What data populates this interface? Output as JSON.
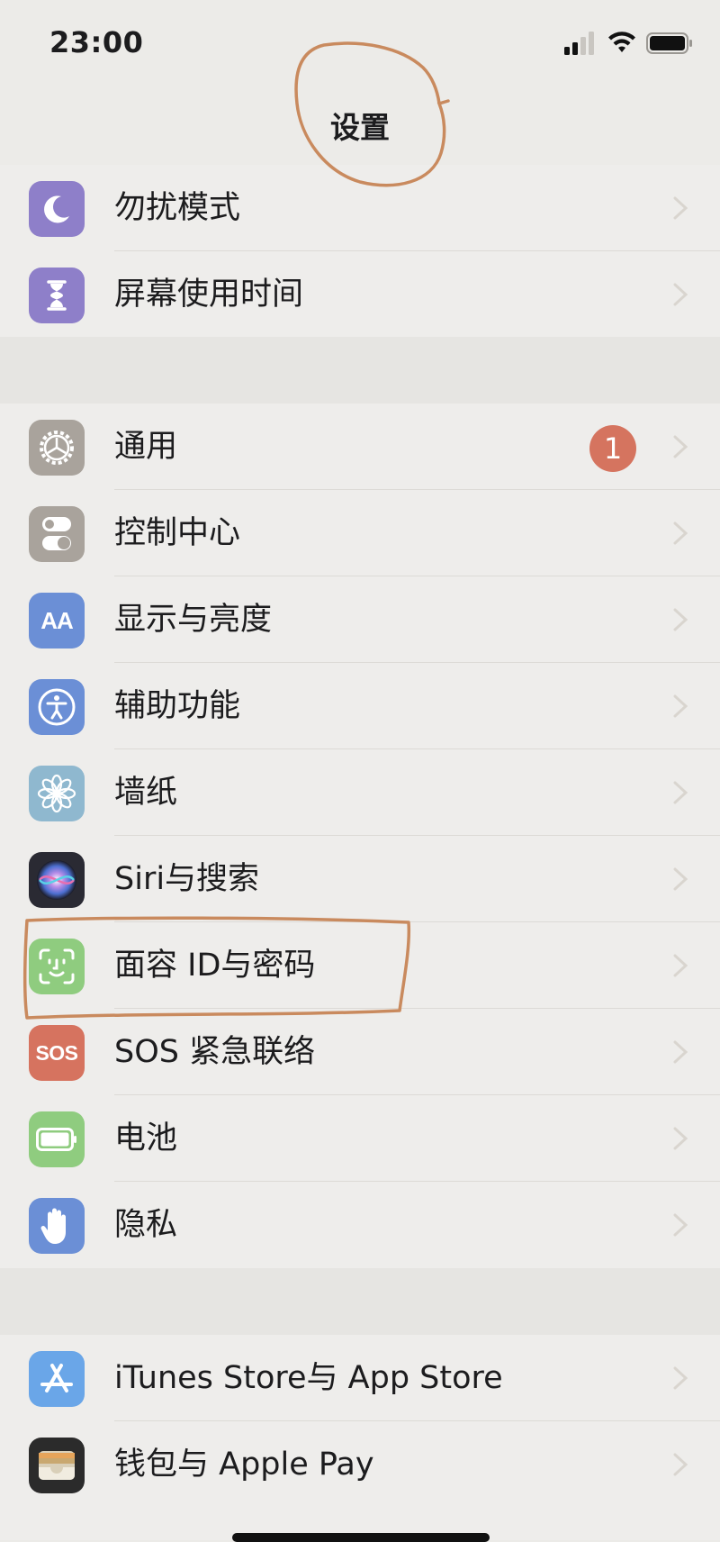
{
  "status_bar": {
    "time": "23:00"
  },
  "nav": {
    "title": "设置"
  },
  "colors": {
    "background": "#ecebe8",
    "badge": "#d5745f",
    "annotation": "#c98a5e",
    "chevron": "#d9d5cf"
  },
  "groups": [
    {
      "items": [
        {
          "label": "勿扰模式",
          "icon": "moon-icon",
          "color": "#8e7fc9"
        },
        {
          "label": "屏幕使用时间",
          "icon": "hourglass-icon",
          "color": "#8e7fc9"
        }
      ]
    },
    {
      "items": [
        {
          "label": "通用",
          "icon": "gear-icon",
          "color": "#a9a39c",
          "badge": "1"
        },
        {
          "label": "控制中心",
          "icon": "toggles-icon",
          "color": "#a9a39c"
        },
        {
          "label": "显示与亮度",
          "icon": "text-size-icon",
          "color": "#6b8fd6"
        },
        {
          "label": "辅助功能",
          "icon": "accessibility-icon",
          "color": "#6b8fd6"
        },
        {
          "label": "墙纸",
          "icon": "flower-icon",
          "color": "#8fb8cf"
        },
        {
          "label": "Siri与搜索",
          "icon": "siri-icon",
          "color": "#2a2a33"
        },
        {
          "label": "面容 ID与密码",
          "icon": "face-id-icon",
          "color": "#8fcc7f"
        },
        {
          "label": "SOS 紧急联络",
          "icon": "sos-icon",
          "color": "#d6735f"
        },
        {
          "label": "电池",
          "icon": "battery-icon",
          "color": "#8fcc7f"
        },
        {
          "label": "隐私",
          "icon": "hand-icon",
          "color": "#6b8fd6"
        }
      ]
    },
    {
      "items": [
        {
          "label": "iTunes Store与 App Store",
          "icon": "app-store-icon",
          "color": "#6aa6e8"
        },
        {
          "label": "钱包与 Apple Pay",
          "icon": "wallet-icon",
          "color": "#2b2b2b"
        }
      ]
    }
  ],
  "icon_text": {
    "sos": "SOS",
    "aa": "AA"
  }
}
